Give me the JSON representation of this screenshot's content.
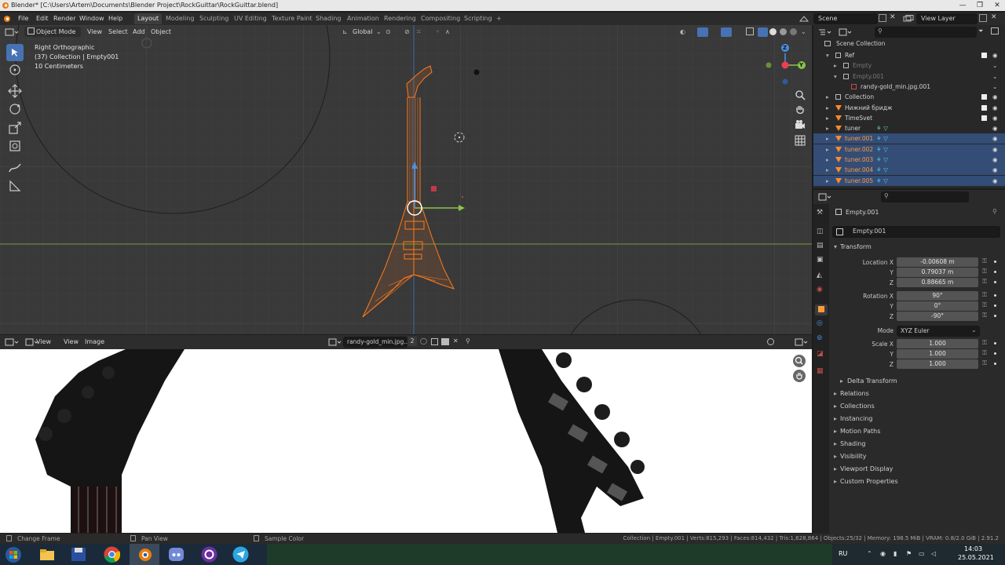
{
  "window": {
    "title": "Blender* [C:\\Users\\Artem\\Documents\\Blender Project\\RockGuittar\\RockGuittar.blend]",
    "controls": [
      "—",
      "❐",
      "✕"
    ]
  },
  "menu": {
    "items": [
      "File",
      "Edit",
      "Render",
      "Window",
      "Help"
    ],
    "workspaces": [
      "Layout",
      "Modeling",
      "Sculpting",
      "UV Editing",
      "Texture Paint",
      "Shading",
      "Animation",
      "Rendering",
      "Compositing",
      "Scripting"
    ],
    "add_tab": "+",
    "scene": "Scene",
    "view_layer": "View Layer"
  },
  "viewport": {
    "mode": "Object Mode",
    "menus": [
      "View",
      "Select",
      "Add",
      "Object"
    ],
    "orientation": "Global",
    "info": [
      "Right Orthographic",
      "(37) Collection | Empty001",
      "10 Centimeters"
    ],
    "gizmo_axes": {
      "z": "Z",
      "y": "Y"
    }
  },
  "image_editor": {
    "menus": [
      "View",
      "View",
      "Image"
    ],
    "image_name": "randy-gold_min.jpg...",
    "users": "2"
  },
  "outliner": {
    "search_placeholder": "",
    "title": "Scene Collection",
    "rows": [
      {
        "label": "Ref",
        "selected": false,
        "dim": false
      },
      {
        "label": "Empty",
        "selected": false,
        "dim": true
      },
      {
        "label": "Empty.001",
        "selected": false,
        "dim": true
      },
      {
        "label": "randy-gold_min.jpg.001",
        "selected": false,
        "dim": false
      },
      {
        "label": "Collection",
        "selected": false,
        "dim": false
      },
      {
        "label": "Нижний бридж",
        "selected": false,
        "dim": false
      },
      {
        "label": "TimeSvet",
        "selected": false,
        "dim": false
      },
      {
        "label": "tuner",
        "selected": false,
        "dim": false
      },
      {
        "label": "tuner.001",
        "selected": true,
        "dim": false
      },
      {
        "label": "tuner.002",
        "selected": true,
        "dim": false
      },
      {
        "label": "tuner.003",
        "selected": true,
        "dim": false
      },
      {
        "label": "tuner.004",
        "selected": true,
        "dim": false
      },
      {
        "label": "tuner.005",
        "selected": true,
        "dim": false
      }
    ]
  },
  "properties": {
    "object_name": "Empty.001",
    "data_name": "Empty.001",
    "transform_title": "Transform",
    "location": {
      "label": "Location X",
      "x": "-0.00608 m",
      "y": "0.79037 m",
      "z": "0.88665 m"
    },
    "rotation": {
      "label": "Rotation X",
      "x": "90°",
      "y": "0°",
      "z": "-90°"
    },
    "mode_label": "Mode",
    "mode_value": "XYZ Euler",
    "scale": {
      "label": "Scale X",
      "x": "1.000",
      "y": "1.000",
      "z": "1.000"
    },
    "axis_y": "Y",
    "axis_z": "Z",
    "delta": "Delta Transform",
    "panels": [
      "Relations",
      "Collections",
      "Instancing",
      "Motion Paths",
      "Shading",
      "Visibility",
      "Viewport Display",
      "Custom Properties"
    ]
  },
  "status": {
    "left1": "Change Frame",
    "left2": "Pan View",
    "left3": "Sample Color",
    "right": "Collection | Empty.001 | Verts:815,293 | Faces:814,432 | Tris:1,628,864 | Objects:25/32 | Memory: 198.5 MiB | VRAM: 0.8/2.0 GiB | 2.91.2"
  },
  "taskbar": {
    "lang": "RU",
    "time": "14:03",
    "date": "25.05.2021"
  },
  "colors": {
    "selection": "#ff8a2a",
    "accent_blue": "#4772b3",
    "x_axis": "#ee3e54",
    "y_axis": "#8bc34a",
    "z_axis": "#4a90e2"
  }
}
